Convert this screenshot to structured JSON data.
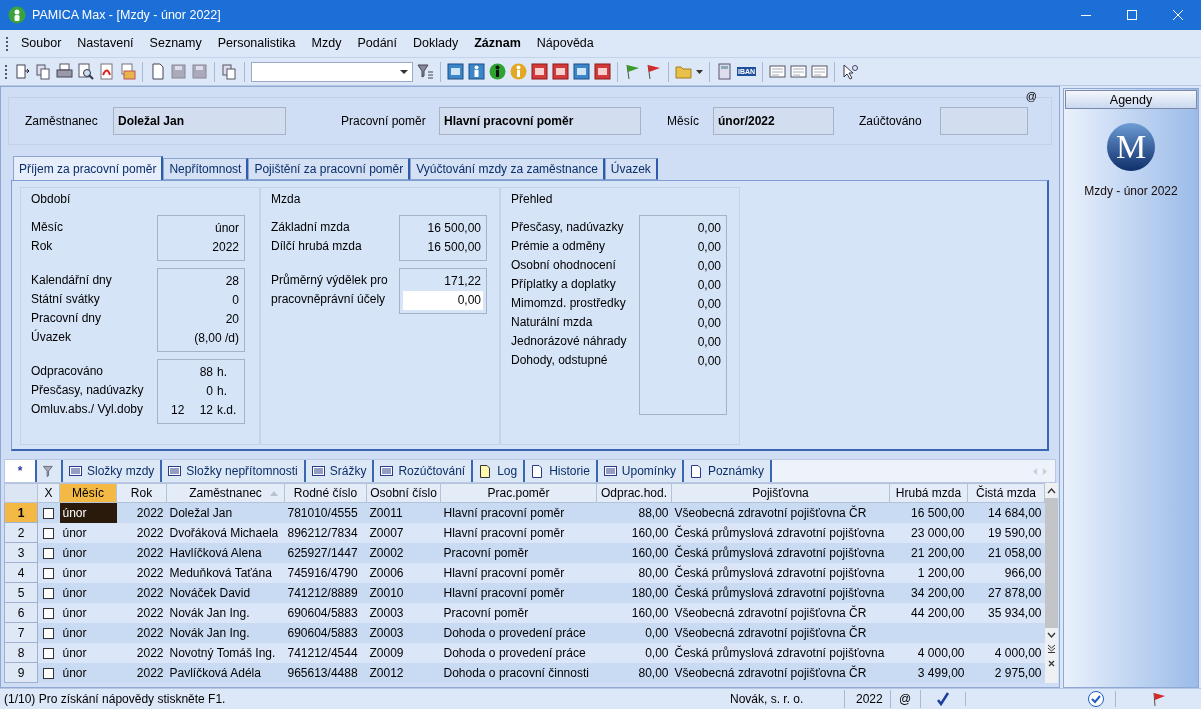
{
  "window": {
    "title": "PAMICA Max - [Mzdy - únor 2022]"
  },
  "menu": [
    {
      "label": "Soubor",
      "bold": false
    },
    {
      "label": "Nastavení",
      "bold": false
    },
    {
      "label": "Seznamy",
      "bold": false
    },
    {
      "label": "Personalistika",
      "bold": false
    },
    {
      "label": "Mzdy",
      "bold": false
    },
    {
      "label": "Podání",
      "bold": false
    },
    {
      "label": "Doklady",
      "bold": false
    },
    {
      "label": "Záznam",
      "bold": true
    },
    {
      "label": "Nápověda",
      "bold": false
    }
  ],
  "toolbar": {
    "iban_label": "IBAN"
  },
  "header": {
    "mark": "@",
    "fields": [
      {
        "label": "Zaměstnanec",
        "value": "Doležal Jan"
      },
      {
        "label": "Pracovní poměr",
        "value": "Hlavní pracovní poměr"
      },
      {
        "label": "Měsíc",
        "value": "únor/2022"
      },
      {
        "label": "Zaúčtováno"
      }
    ]
  },
  "tabs": [
    {
      "label": "Příjem za pracovní poměr",
      "selected": true
    },
    {
      "label": "Nepřítomnost",
      "selected": false
    },
    {
      "label": "Pojištění za pracovní poměr",
      "selected": false
    },
    {
      "label": "Vyúčtování mzdy za zaměstnance",
      "selected": false
    },
    {
      "label": "Úvazek",
      "selected": false
    }
  ],
  "sections": [
    {
      "title": "Období",
      "groups": [
        [
          {
            "label": "Měsíc",
            "values": [
              "únor"
            ]
          },
          {
            "label": "Rok",
            "values": [
              "2022"
            ]
          }
        ],
        [
          {
            "label": "Kalendářní dny",
            "values": [
              "28"
            ]
          },
          {
            "label": "Státní svátky",
            "values": [
              "0"
            ]
          },
          {
            "label": "Pracovní dny",
            "values": [
              "20"
            ]
          },
          {
            "label": "Úvazek",
            "values": [
              "(8,00 /d)"
            ]
          }
        ],
        [
          {
            "label": "Odpracováno",
            "values": [
              "88",
              "h."
            ]
          },
          {
            "label": "Přesčasy, nadúvazky",
            "values": [
              "0",
              "h."
            ]
          },
          {
            "label": "Omluv.abs./ Vyl.doby",
            "values": [
              "12",
              "12",
              "k.d."
            ]
          }
        ]
      ]
    },
    {
      "title": "Mzda",
      "groups": [
        [
          {
            "label": "Základní mzda",
            "values": [
              "16 500,00"
            ]
          },
          {
            "label": "Dílčí hrubá mzda",
            "values": [
              "16 500,00"
            ]
          }
        ],
        [
          {
            "label": "Průměrný výdělek pro",
            "values": [
              "171,22"
            ]
          },
          {
            "label": "pracovněprávní účely",
            "values": [
              "0,00"
            ],
            "kind": "input"
          }
        ]
      ]
    },
    {
      "title": "Přehled",
      "groups": [
        [
          {
            "label": "Přesčasy, nadúvazky",
            "values": [
              "0,00"
            ]
          },
          {
            "label": "Prémie a odměny",
            "values": [
              "0,00"
            ]
          },
          {
            "label": "Osobní ohodnocení",
            "values": [
              "0,00"
            ]
          },
          {
            "label": "Příplatky a doplatky",
            "values": [
              "0,00"
            ]
          },
          {
            "label": "Mimomzd. prostředky",
            "values": [
              "0,00"
            ]
          },
          {
            "label": "Naturální mzda",
            "values": [
              "0,00"
            ]
          },
          {
            "label": "Jednorázové náhrady",
            "values": [
              "0,00"
            ]
          },
          {
            "label": "Dohody, odstupné",
            "values": [
              "0,00"
            ]
          }
        ]
      ]
    }
  ],
  "bottom_tabs": [
    {
      "label": "*",
      "kind": "star",
      "selected": true
    },
    {
      "kind": "filter",
      "selected": false
    },
    {
      "label": "Složky mzdy",
      "kind": "list",
      "selected": false
    },
    {
      "label": "Složky nepřítomnosti",
      "kind": "list",
      "selected": false
    },
    {
      "label": "Srážky",
      "kind": "list",
      "selected": false
    },
    {
      "label": "Rozúčtování",
      "kind": "list",
      "selected": false
    },
    {
      "label": "Log",
      "kind": "note",
      "selected": false
    },
    {
      "label": "Historie",
      "kind": "page",
      "selected": false
    },
    {
      "label": "Upomínky",
      "kind": "list",
      "selected": false
    },
    {
      "label": "Poznámky",
      "kind": "page",
      "selected": false
    }
  ],
  "table": {
    "checkbox_header": "X",
    "columns": [
      {
        "label": "Měsíc",
        "current": true,
        "sorted": false
      },
      {
        "label": "Rok",
        "current": false,
        "sorted": false
      },
      {
        "label": "Zaměstnanec",
        "current": false,
        "sorted": true
      },
      {
        "label": "Rodné číslo",
        "current": false,
        "sorted": false
      },
      {
        "label": "Osobní číslo",
        "current": false,
        "sorted": false
      },
      {
        "label": "Prac.poměr",
        "current": false,
        "sorted": false
      },
      {
        "label": "Odprac.hod.",
        "current": false,
        "sorted": false
      },
      {
        "label": "Pojišťovna",
        "current": false,
        "sorted": false
      },
      {
        "label": "Hrubá mzda",
        "current": false,
        "sorted": false
      },
      {
        "label": "Čistá mzda",
        "current": false,
        "sorted": false
      }
    ],
    "rows": [
      {
        "number": "1",
        "selected": true,
        "checked": false,
        "cells": [
          "únor",
          "2022",
          "Doležal Jan",
          "781010/4555",
          "Z0011",
          "Hlavní pracovní poměr",
          "88,00",
          "Všeobecná zdravotní pojišťovna ČR",
          "16 500,00",
          "14 684,00"
        ]
      },
      {
        "number": "2",
        "selected": false,
        "checked": false,
        "cells": [
          "únor",
          "2022",
          "Dvořáková Michaela",
          "896212/7834",
          "Z0007",
          "Hlavní pracovní poměr",
          "160,00",
          "Česká průmyslová zdravotní pojišťovna",
          "23 000,00",
          "19 590,00"
        ]
      },
      {
        "number": "3",
        "selected": false,
        "checked": false,
        "cells": [
          "únor",
          "2022",
          "Havlíčková Alena",
          "625927/1447",
          "Z0002",
          "Pracovní poměr",
          "160,00",
          "Česká průmyslová zdravotní pojišťovna",
          "21 200,00",
          "21 058,00"
        ]
      },
      {
        "number": "4",
        "selected": false,
        "checked": false,
        "cells": [
          "únor",
          "2022",
          "Meduňková Taťána",
          "745916/4790",
          "Z0006",
          "Hlavní pracovní poměr",
          "80,00",
          "Česká průmyslová zdravotní pojišťovna",
          "1 200,00",
          "966,00"
        ]
      },
      {
        "number": "5",
        "selected": false,
        "checked": false,
        "cells": [
          "únor",
          "2022",
          "Nováček David",
          "741212/8889",
          "Z0010",
          "Hlavní pracovní poměr",
          "180,00",
          "Česká průmyslová zdravotní pojišťovna",
          "34 200,00",
          "27 878,00"
        ]
      },
      {
        "number": "6",
        "selected": false,
        "checked": false,
        "cells": [
          "únor",
          "2022",
          "Novák Jan Ing.",
          "690604/5883",
          "Z0003",
          "Pracovní poměr",
          "160,00",
          "Všeobecná zdravotní pojišťovna ČR",
          "44 200,00",
          "35 934,00"
        ]
      },
      {
        "number": "7",
        "selected": false,
        "checked": false,
        "cells": [
          "únor",
          "2022",
          "Novák Jan Ing.",
          "690604/5883",
          "Z0003",
          "Dohoda o provedení práce",
          "0,00",
          "Všeobecná zdravotní pojišťovna ČR",
          null,
          null
        ]
      },
      {
        "number": "8",
        "selected": false,
        "checked": false,
        "cells": [
          "únor",
          "2022",
          "Novotný Tomáš Ing.",
          "741212/4544",
          "Z0009",
          "Dohoda o provedení práce",
          "0,00",
          "Česká průmyslová zdravotní pojišťovna",
          "4 000,00",
          "4 000,00"
        ]
      },
      {
        "number": "9",
        "selected": false,
        "checked": false,
        "cells": [
          "únor",
          "2022",
          "Pavlíčková Adéla",
          "965613/4488",
          "Z0012",
          "Dohoda o pracovní činnosti",
          "80,00",
          "Všeobecná zdravotní pojišťovna ČR",
          "3 499,00",
          "2 975,00"
        ]
      }
    ]
  },
  "side_panel": {
    "header": "Agendy",
    "logo_letter": "M",
    "caption": "Mzdy - únor 2022"
  },
  "status_bar": {
    "message": "(1/10) Pro získání nápovědy stiskněte F1.",
    "company": "Novák, s. r. o.",
    "year": "2022",
    "mark": "@"
  }
}
